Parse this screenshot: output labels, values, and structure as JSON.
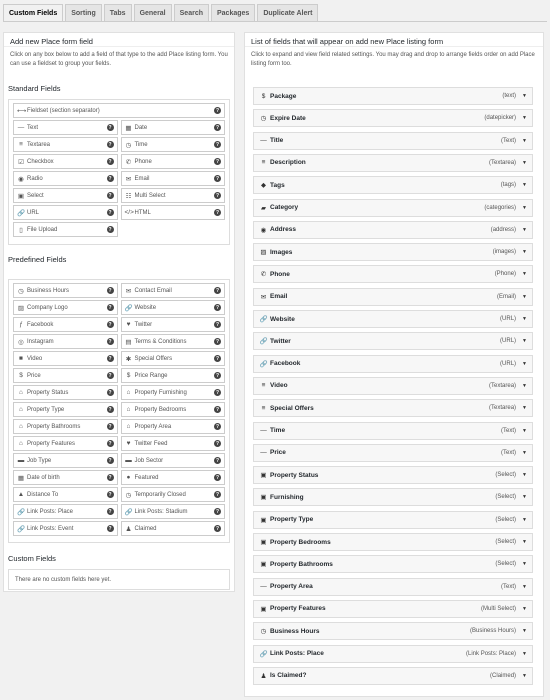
{
  "tabs": [
    "Custom Fields",
    "Sorting",
    "Tabs",
    "General",
    "Search",
    "Packages",
    "Duplicate Alert"
  ],
  "left": {
    "title": "Add new Place form field",
    "description": "Click on any box below to add a field of that type to the add Place listing form. You can use a fieldset to group your fields.",
    "standard_title": "Standard Fields",
    "standard": [
      {
        "label": "Fieldset (section separator)",
        "icon": "⟷",
        "full": true
      },
      {
        "label": "Text",
        "icon": "—"
      },
      {
        "label": "Date",
        "icon": "▦"
      },
      {
        "label": "Textarea",
        "icon": "≡"
      },
      {
        "label": "Time",
        "icon": "◷"
      },
      {
        "label": "Checkbox",
        "icon": "☑"
      },
      {
        "label": "Phone",
        "icon": "✆"
      },
      {
        "label": "Radio",
        "icon": "◉"
      },
      {
        "label": "Email",
        "icon": "✉"
      },
      {
        "label": "Select",
        "icon": "▣"
      },
      {
        "label": "Multi Select",
        "icon": "☷"
      },
      {
        "label": "URL",
        "icon": "🔗"
      },
      {
        "label": "HTML",
        "icon": "</>"
      },
      {
        "label": "File Upload",
        "icon": "▯"
      }
    ],
    "predefined_title": "Predefined Fields",
    "predefined": [
      {
        "label": "Business Hours",
        "icon": "◷"
      },
      {
        "label": "Contact Email",
        "icon": "✉"
      },
      {
        "label": "Company Logo",
        "icon": "▨"
      },
      {
        "label": "Website",
        "icon": "🔗"
      },
      {
        "label": "Facebook",
        "icon": "ƒ"
      },
      {
        "label": "Twitter",
        "icon": "♥"
      },
      {
        "label": "Instagram",
        "icon": "◎"
      },
      {
        "label": "Terms & Conditions",
        "icon": "▤"
      },
      {
        "label": "Video",
        "icon": "■"
      },
      {
        "label": "Special Offers",
        "icon": "✱"
      },
      {
        "label": "Price",
        "icon": "$"
      },
      {
        "label": "Price Range",
        "icon": "$"
      },
      {
        "label": "Property Status",
        "icon": "⌂"
      },
      {
        "label": "Property Furnishing",
        "icon": "⌂"
      },
      {
        "label": "Property Type",
        "icon": "⌂"
      },
      {
        "label": "Property Bedrooms",
        "icon": "⌂"
      },
      {
        "label": "Property Bathrooms",
        "icon": "⌂"
      },
      {
        "label": "Property Area",
        "icon": "⌂"
      },
      {
        "label": "Property Features",
        "icon": "⌂"
      },
      {
        "label": "Twitter Feed",
        "icon": "♥"
      },
      {
        "label": "Job Type",
        "icon": "▬"
      },
      {
        "label": "Job Sector",
        "icon": "▬"
      },
      {
        "label": "Date of birth",
        "icon": "▦"
      },
      {
        "label": "Featured",
        "icon": "●"
      },
      {
        "label": "Distance To",
        "icon": "▲"
      },
      {
        "label": "Temporarily Closed",
        "icon": "◷"
      },
      {
        "label": "Link Posts: Place",
        "icon": "🔗"
      },
      {
        "label": "Link Posts: Stadium",
        "icon": "🔗"
      },
      {
        "label": "Link Posts: Event",
        "icon": "🔗"
      },
      {
        "label": "Claimed",
        "icon": "♟"
      }
    ],
    "custom_title": "Custom Fields",
    "custom_empty": "There are no custom fields here yet."
  },
  "right": {
    "title": "List of fields that will appear on add new Place listing form",
    "description": "Click to expand and view field related settings. You may drag and drop to arrange fields order on add Place listing form too.",
    "fields": [
      {
        "label": "Package",
        "type": "(text)",
        "icon": "$"
      },
      {
        "label": "Expire Date",
        "type": "(datepicker)",
        "icon": "◷"
      },
      {
        "label": "Title",
        "type": "(Text)",
        "icon": "—"
      },
      {
        "label": "Description",
        "type": "(Textarea)",
        "icon": "≡"
      },
      {
        "label": "Tags",
        "type": "(tags)",
        "icon": "◆"
      },
      {
        "label": "Category",
        "type": "(categories)",
        "icon": "▰"
      },
      {
        "label": "Address",
        "type": "(address)",
        "icon": "◉"
      },
      {
        "label": "Images",
        "type": "(images)",
        "icon": "▨"
      },
      {
        "label": "Phone",
        "type": "(Phone)",
        "icon": "✆"
      },
      {
        "label": "Email",
        "type": "(Email)",
        "icon": "✉"
      },
      {
        "label": "Website",
        "type": "(URL)",
        "icon": "🔗"
      },
      {
        "label": "Twitter",
        "type": "(URL)",
        "icon": "🔗"
      },
      {
        "label": "Facebook",
        "type": "(URL)",
        "icon": "🔗"
      },
      {
        "label": "Video",
        "type": "(Textarea)",
        "icon": "≡"
      },
      {
        "label": "Special Offers",
        "type": "(Textarea)",
        "icon": "≡"
      },
      {
        "label": "Time",
        "type": "(Text)",
        "icon": "—"
      },
      {
        "label": "Price",
        "type": "(Text)",
        "icon": "—"
      },
      {
        "label": "Property Status",
        "type": "(Select)",
        "icon": "▣"
      },
      {
        "label": "Furnishing",
        "type": "(Select)",
        "icon": "▣"
      },
      {
        "label": "Property Type",
        "type": "(Select)",
        "icon": "▣"
      },
      {
        "label": "Property Bedrooms",
        "type": "(Select)",
        "icon": "▣"
      },
      {
        "label": "Property Bathrooms",
        "type": "(Select)",
        "icon": "▣"
      },
      {
        "label": "Property Area",
        "type": "(Text)",
        "icon": "—"
      },
      {
        "label": "Property Features",
        "type": "(Multi Select)",
        "icon": "▣"
      },
      {
        "label": "Business Hours",
        "type": "(Business Hours)",
        "icon": "◷"
      },
      {
        "label": "Link Posts: Place",
        "type": "(Link Posts: Place)",
        "icon": "🔗"
      },
      {
        "label": "Is Claimed?",
        "type": "(Claimed)",
        "icon": "♟"
      }
    ]
  }
}
